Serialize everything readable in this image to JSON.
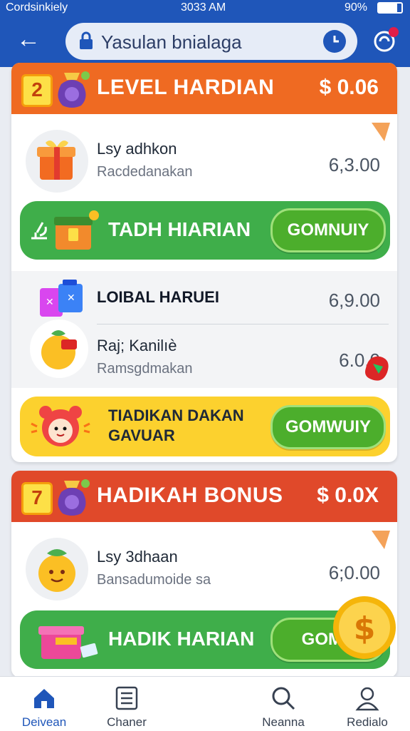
{
  "status_bar": {
    "carrier": "Cordsinkiely",
    "time": "3033 AM",
    "battery": "90%"
  },
  "header": {
    "back_icon": "back-arrow-icon",
    "url": "Yasulan bnialaga",
    "notification_icon": "notification-icon"
  },
  "sections": [
    {
      "badge": "2",
      "title": "LEVEL HARDIAN",
      "amount": "$ 0.06",
      "color": "#ef6a22",
      "rows": [
        {
          "title": "Lsy adhkon",
          "subtitle": "Racdedanakan",
          "value": "6,3.00"
        }
      ],
      "action": {
        "title": "TADH HIARIAN",
        "button": "GOMNUIY",
        "color": "#3fae4a"
      },
      "sub_rows": [
        {
          "title": "LOIBAL HARUEI",
          "subtitle": "",
          "value": "6,9.00"
        },
        {
          "title": "Raj; Kanilıè",
          "subtitle": "Ramsgdmakan",
          "value": "6.0.0"
        }
      ],
      "promo": {
        "title_line1": "TIADIKAN DAKAN",
        "title_line2": "GAVUAR",
        "button": "GOMWUIY",
        "color": "#fcd12e"
      }
    },
    {
      "badge": "7",
      "title": "HADIKAH BONUS",
      "amount": "$ 0.0X",
      "color": "#e0492a",
      "rows": [
        {
          "title": "Lsy 3dhaan",
          "subtitle": "Bansadumoide sa",
          "value": "6;0.00"
        }
      ],
      "action": {
        "title": "HADIK HARIAN",
        "button": "GOMN",
        "color": "#3fae4a"
      }
    }
  ],
  "bottom_nav": [
    {
      "label": "Deivean",
      "icon": "home-icon",
      "active": true
    },
    {
      "label": "Chaner",
      "icon": "list-icon",
      "active": false
    },
    {
      "label": "Neanna",
      "icon": "search-icon",
      "active": false
    },
    {
      "label": "Redialo",
      "icon": "profile-icon",
      "active": false
    }
  ]
}
